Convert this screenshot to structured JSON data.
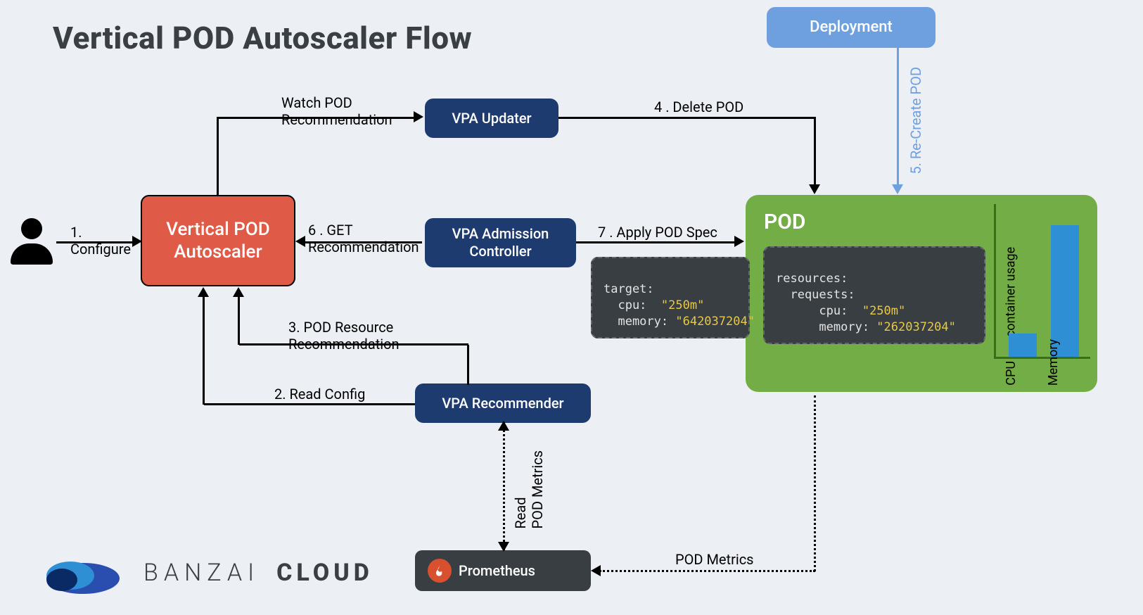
{
  "title": "Vertical POD Autoscaler Flow",
  "nodes": {
    "deployment": "Deployment",
    "vpa": "Vertical POD\nAutoscaler",
    "updater": "VPA Updater",
    "admission": "VPA Admission\nController",
    "recommender": "VPA Recommender",
    "prometheus": "Prometheus",
    "pod": "POD"
  },
  "edges": {
    "configure": "1.\nConfigure",
    "readConfig": "2. Read Config",
    "podResourceRec": "3. POD Resource\nRecommendation",
    "watchRec": "Watch POD\nRecommendation",
    "deletePod": "4 . Delete POD",
    "recreate": "5. Re-Create POD",
    "getRec": "6 . GET\nRecommendation",
    "applySpec": "7 . Apply POD Spec",
    "readMetrics": "Read\nPOD Metrics",
    "podMetrics": "POD Metrics"
  },
  "targetSpec": {
    "l1": "target:",
    "l2": "  cpu:  ",
    "v2": "\"250m\"",
    "l3": "  memory: ",
    "v3": "\"642037204\""
  },
  "podSpec": {
    "l1": "resources:",
    "l2": "  requests:",
    "l3": "      cpu:  ",
    "v3": "\"250m\"",
    "l4": "      memory: ",
    "v4": "\"262037204\""
  },
  "chart_data": {
    "type": "bar",
    "categories": [
      "CPU",
      "Memory"
    ],
    "values": [
      15,
      85
    ],
    "title": "",
    "xlabel": "",
    "ylabel": "container usage",
    "ylim": [
      0,
      100
    ]
  },
  "brand": {
    "part1": "BANZAI",
    "part2": "CLOUD"
  }
}
